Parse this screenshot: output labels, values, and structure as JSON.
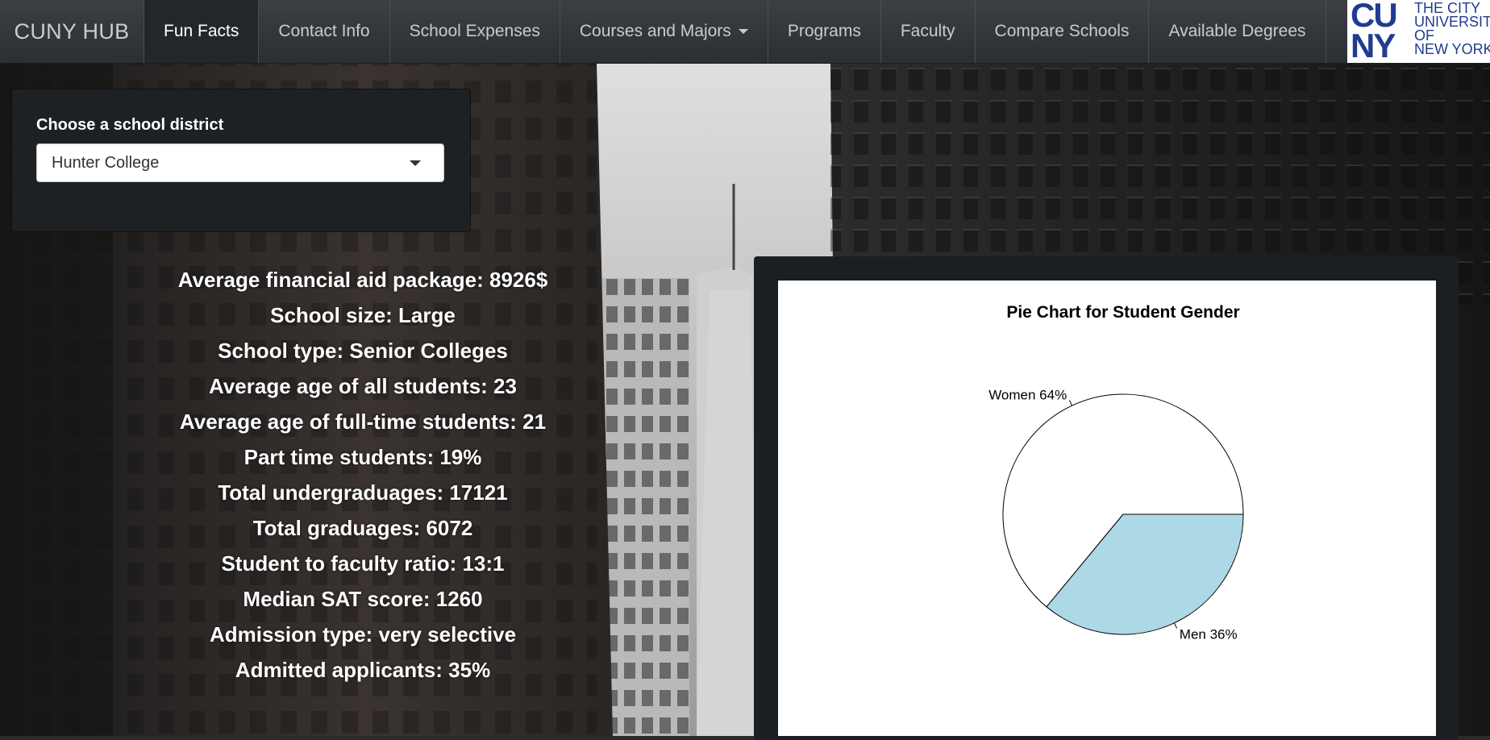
{
  "navbar": {
    "brand": "CUNY HUB",
    "items": [
      {
        "label": "Fun Facts",
        "active": true
      },
      {
        "label": "Contact Info"
      },
      {
        "label": "School Expenses"
      },
      {
        "label": "Courses and Majors",
        "dropdown": true
      },
      {
        "label": "Programs"
      },
      {
        "label": "Faculty"
      },
      {
        "label": "Compare Schools"
      },
      {
        "label": "Available Degrees"
      }
    ],
    "logo": {
      "mark_top": "CU",
      "mark_bottom": "NY",
      "words": [
        "THE CITY",
        "UNIVERSITY",
        "OF",
        "NEW YORK"
      ]
    }
  },
  "selector": {
    "label": "Choose a school district",
    "value": "Hunter College"
  },
  "facts": [
    "Average financial aid package: 8926$",
    "School size: Large",
    "School type: Senior Colleges",
    "Average age of all students: 23",
    "Average age of full-time students: 21",
    "Part time students: 19%",
    "Total undergraduages: 17121",
    "Total graduages: 6072",
    "Student to faculty ratio: 13:1",
    "Median SAT score: 1260",
    "Admission type: very selective",
    "Admitted applicants: 35%"
  ],
  "chart_data": {
    "type": "pie",
    "title": "Pie Chart for Student Gender",
    "slices": [
      {
        "label": "Women 64%",
        "value": 64,
        "color": "#ffffff"
      },
      {
        "label": "Men 36%",
        "value": 36,
        "color": "#add8e6"
      }
    ]
  },
  "colors": {
    "nav_bg": "#2b2f33",
    "panel_bg": "#1e2124",
    "pie_men": "#add8e6",
    "cuny_blue": "#1f3c8f"
  }
}
